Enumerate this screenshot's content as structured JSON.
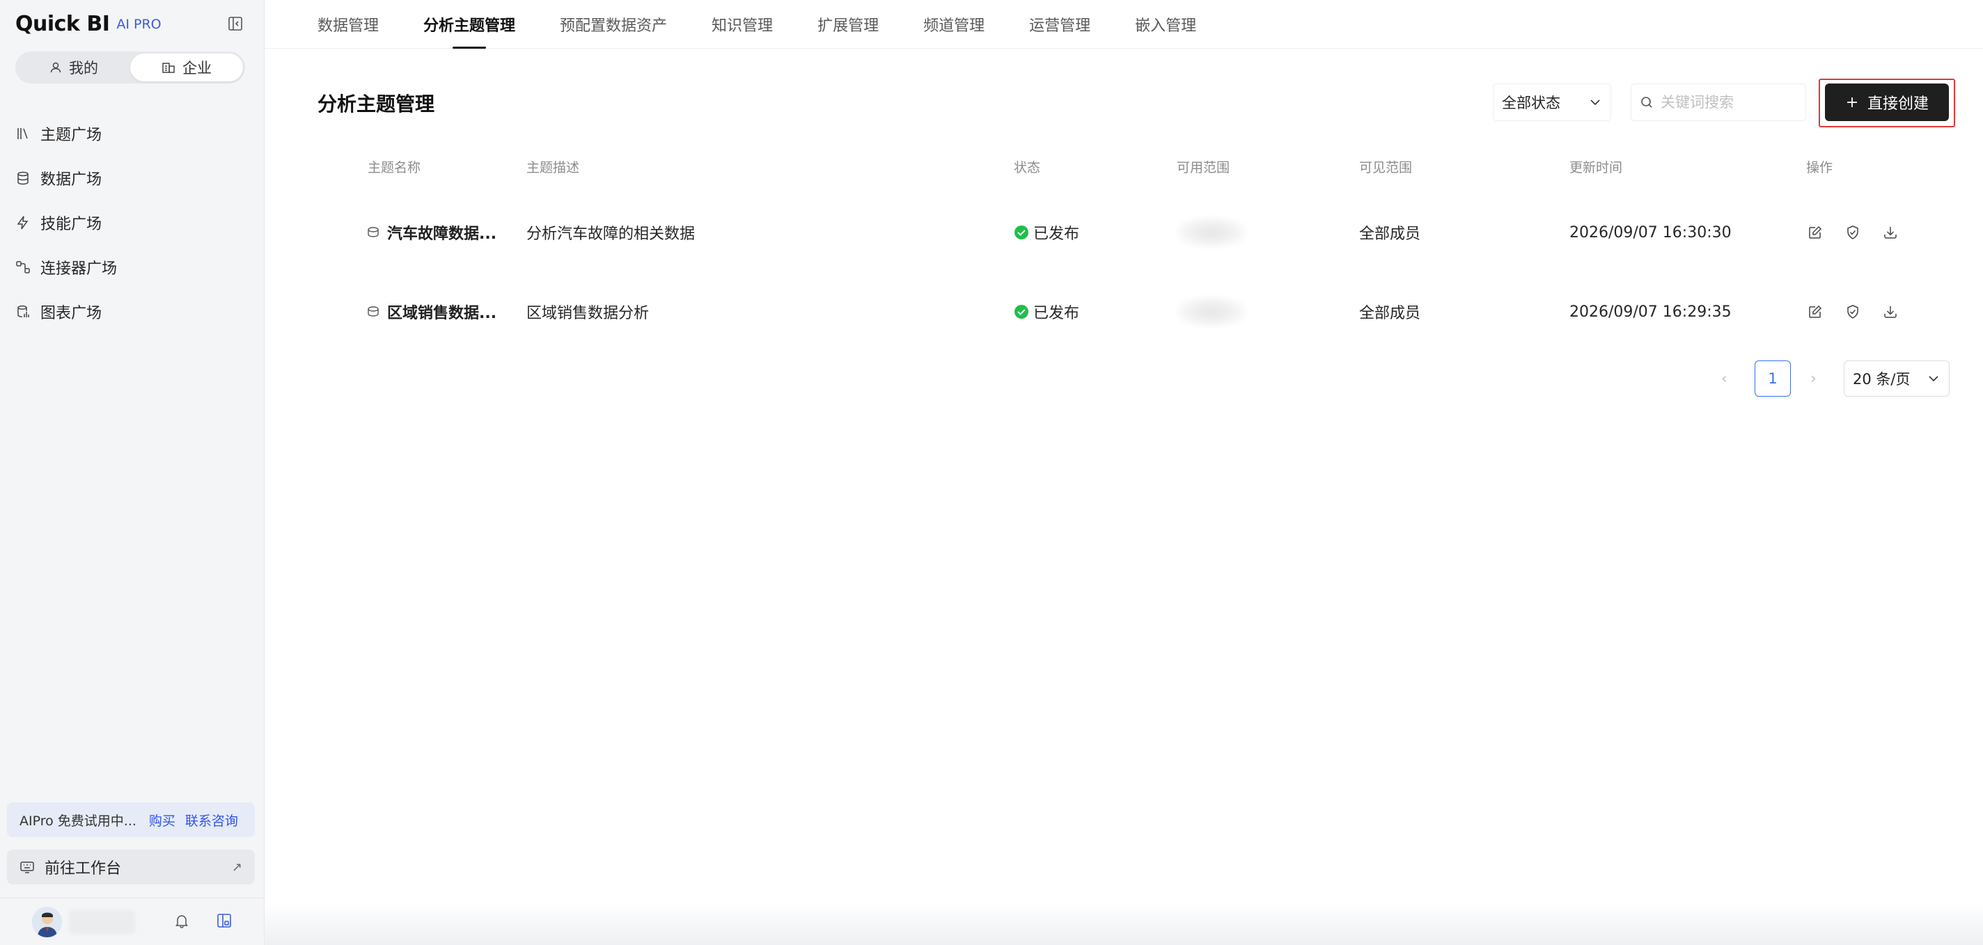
{
  "app": {
    "logo": "Quick BI",
    "badge": "AI PRO"
  },
  "sidebar": {
    "segments": [
      {
        "label": "我的",
        "active": false
      },
      {
        "label": "企业",
        "active": true
      }
    ],
    "items": [
      {
        "label": "主题广场",
        "icon": "books-icon"
      },
      {
        "label": "数据广场",
        "icon": "database-icon"
      },
      {
        "label": "技能广场",
        "icon": "lightning-icon"
      },
      {
        "label": "连接器广场",
        "icon": "connector-icon"
      },
      {
        "label": "图表广场",
        "icon": "chart-db-icon"
      }
    ],
    "promo": {
      "text": "AIPro 免费试用中...",
      "buy": "购买",
      "contact": "联系咨询"
    },
    "workbench": {
      "label": "前往工作台",
      "arrow": "↗"
    }
  },
  "tabs": [
    {
      "label": "数据管理",
      "active": false
    },
    {
      "label": "分析主题管理",
      "active": true
    },
    {
      "label": "预配置数据资产",
      "active": false
    },
    {
      "label": "知识管理",
      "active": false
    },
    {
      "label": "扩展管理",
      "active": false
    },
    {
      "label": "频道管理",
      "active": false
    },
    {
      "label": "运营管理",
      "active": false
    },
    {
      "label": "嵌入管理",
      "active": false
    }
  ],
  "main": {
    "title": "分析主题管理",
    "status_filter": "全部状态",
    "search_placeholder": "关键词搜索",
    "create_label": "直接创建"
  },
  "table": {
    "headers": [
      "主题名称",
      "主题描述",
      "状态",
      "可用范围",
      "可见范围",
      "更新时间",
      "操作"
    ],
    "rows": [
      {
        "name": "汽车故障数据...",
        "desc": "分析汽车故障的相关数据",
        "status": "已发布",
        "visible": "全部成员",
        "time": "2026/09/07 16:30:30"
      },
      {
        "name": "区域销售数据...",
        "desc": "区域销售数据分析",
        "status": "已发布",
        "visible": "全部成员",
        "time": "2026/09/07 16:29:35"
      }
    ]
  },
  "pagination": {
    "prev": "‹",
    "page": "1",
    "next": "›",
    "page_size": "20 条/页"
  },
  "colors": {
    "accent": "#3b6ef5",
    "published": "#1fbf4a",
    "highlight_frame": "#e03a3a",
    "primary_button": "#1f1f1f"
  }
}
